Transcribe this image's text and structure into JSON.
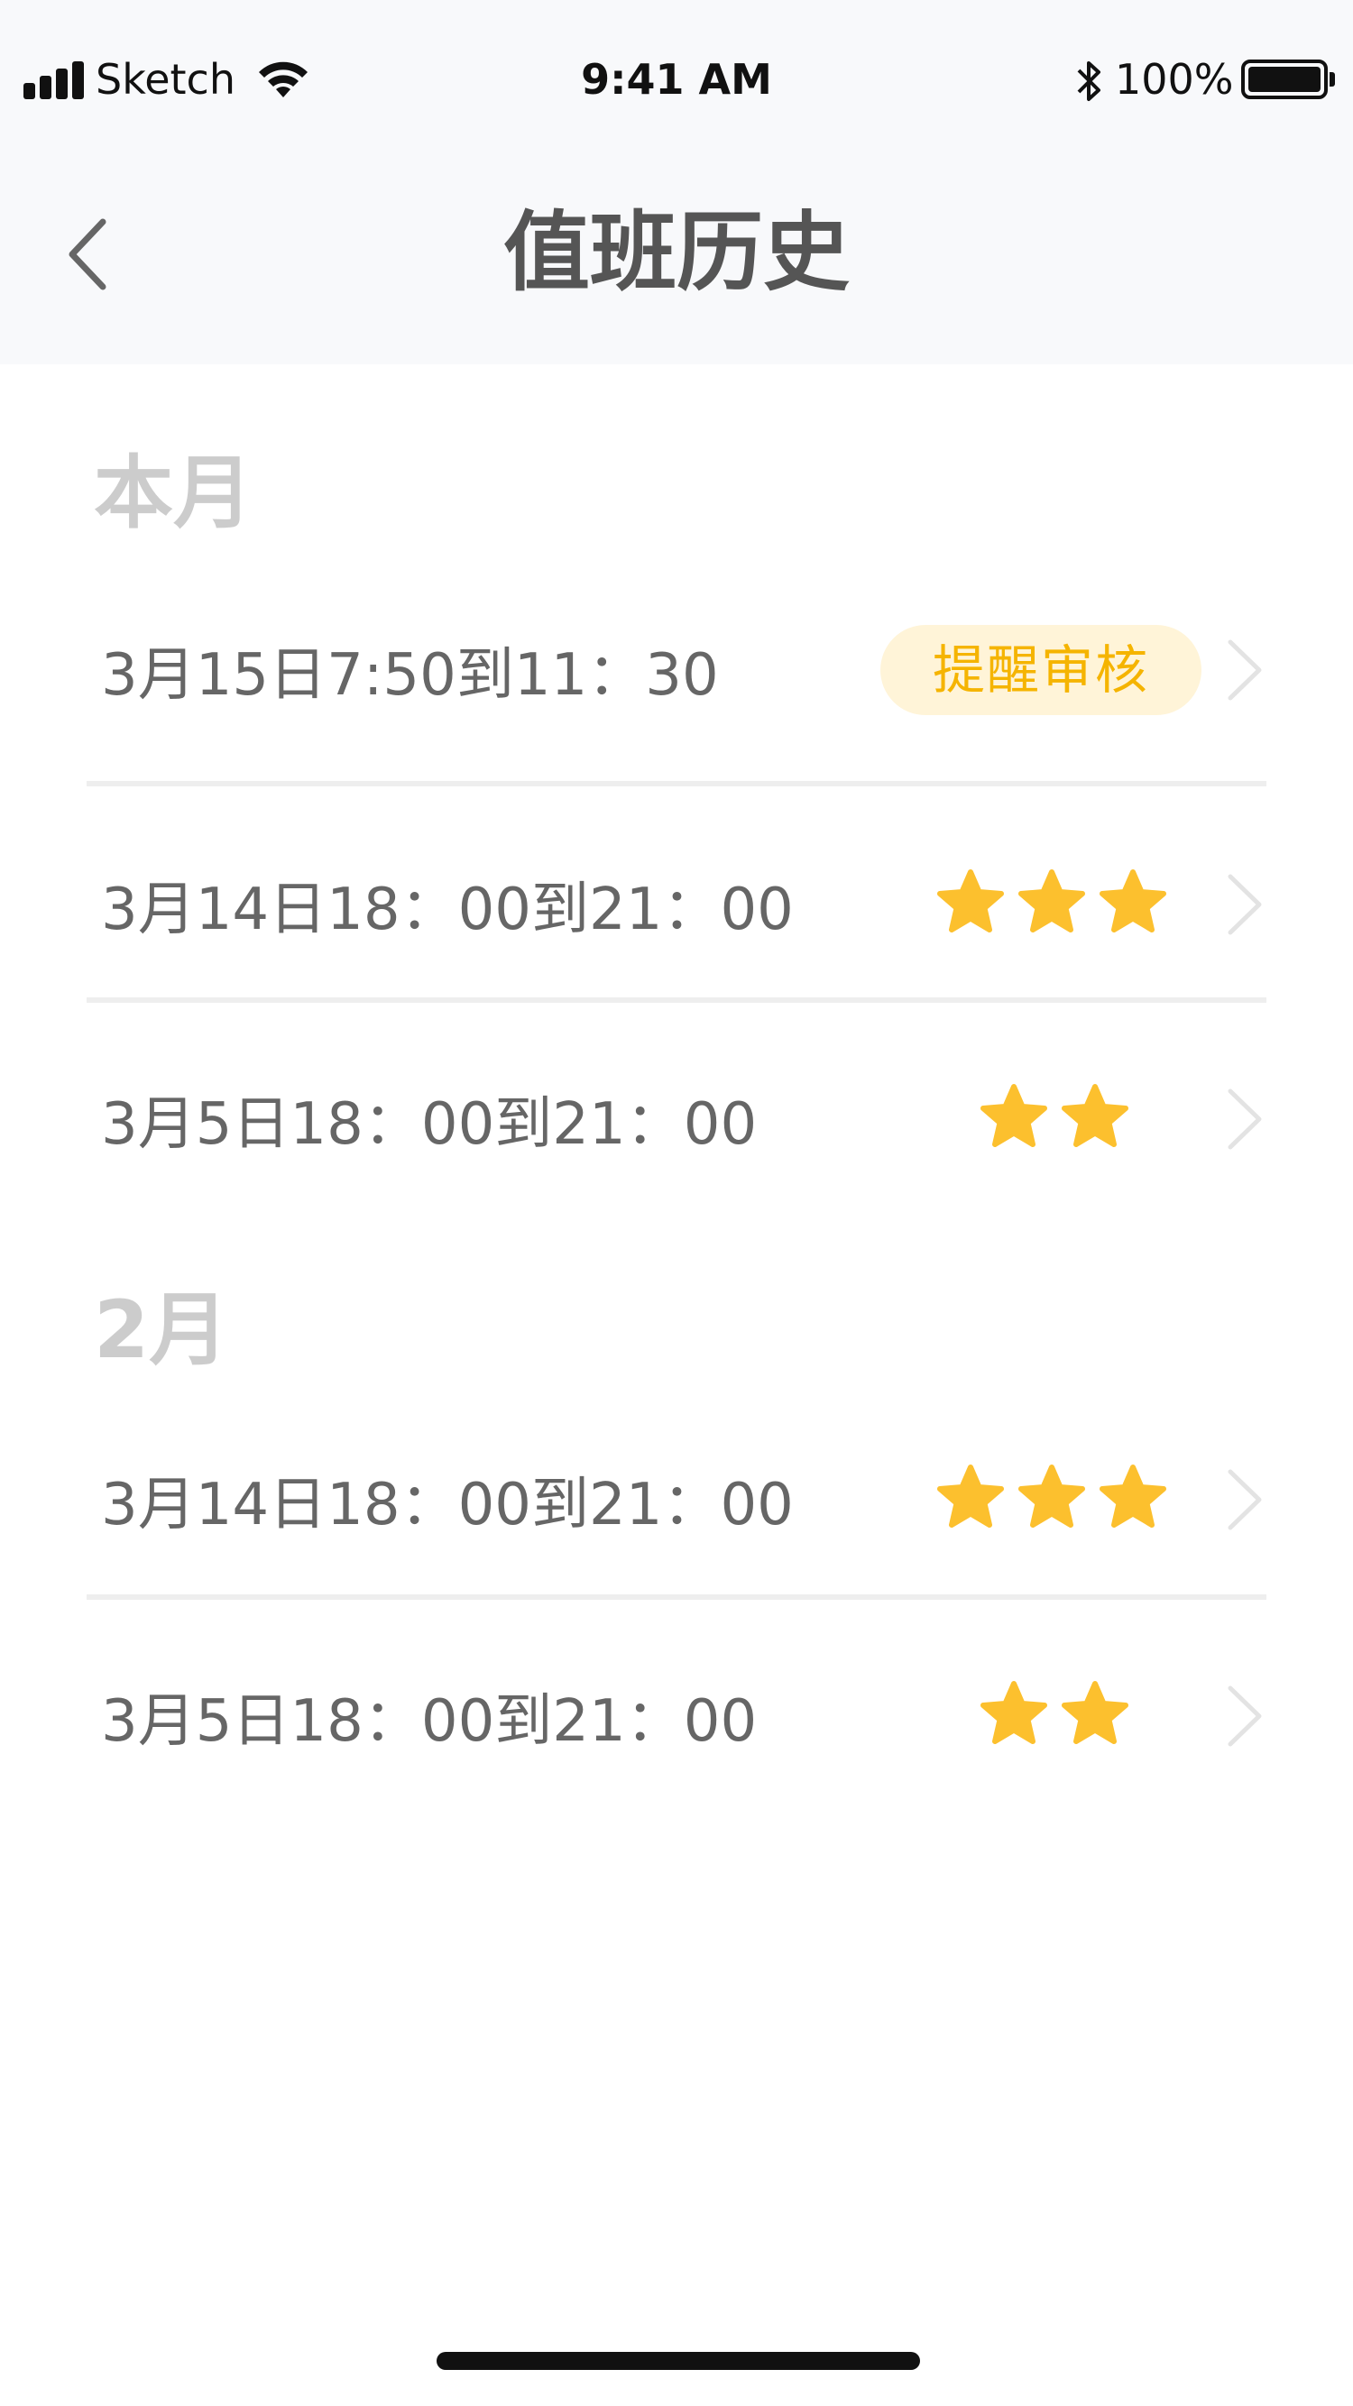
{
  "status_bar": {
    "carrier": "Sketch",
    "time": "9:41 AM",
    "battery": "100%"
  },
  "nav": {
    "title": "值班历史"
  },
  "sections": [
    {
      "title": "本月",
      "rows": [
        {
          "text": "3月15日7:50到11：30",
          "badge": "提醒审核",
          "stars": 0
        },
        {
          "text": "3月14日18：00到21：00",
          "badge": null,
          "stars": 3
        },
        {
          "text": "3月5日18：00到21：00",
          "badge": null,
          "stars": 2
        }
      ]
    },
    {
      "title": "2月",
      "rows": [
        {
          "text": "3月14日18：00到21：00",
          "badge": null,
          "stars": 3
        },
        {
          "text": "3月5日18：00到21：00",
          "badge": null,
          "stars": 2
        }
      ]
    }
  ],
  "colors": {
    "star": "#fcc02e",
    "badge_bg": "#fff4d8",
    "badge_text": "#f5b400"
  },
  "icons": {
    "back": "chevron-left-icon",
    "row_arrow": "chevron-right-icon",
    "rating": "star-icon"
  }
}
